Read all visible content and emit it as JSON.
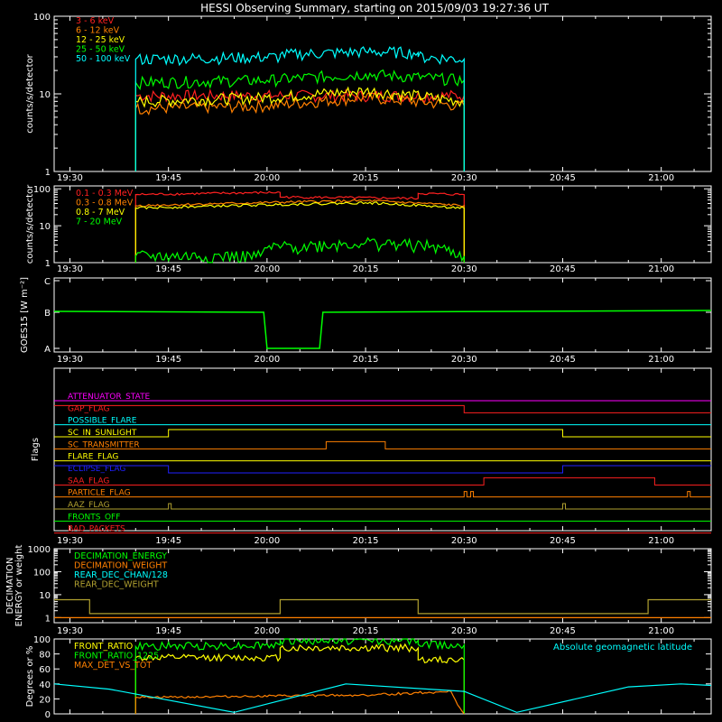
{
  "title": "HESSI Observing Summary, starting on 2015/09/03 19:27:36 UT",
  "time_ticks": [
    "19:30",
    "19:45",
    "20:00",
    "20:15",
    "20:30",
    "20:45",
    "21:00"
  ],
  "colors": {
    "red": "#ff2020",
    "orange": "#ff8000",
    "yellow": "#ffff00",
    "green": "#00ff00",
    "cyan": "#00ffff",
    "magenta": "#ff00ff",
    "blue": "#2020ff",
    "olive": "#b0a030",
    "white": "#ffffff"
  },
  "chart_data": [
    {
      "type": "line",
      "id": "low-energy-rates",
      "ylabel": "counts/s/detector",
      "yscale": "log",
      "ylim": [
        1,
        100
      ],
      "yticks": [
        "1",
        "10",
        "100"
      ],
      "xlim": [
        "19:27:36",
        "21:07:36"
      ],
      "series": [
        {
          "name": "3 - 6 keV",
          "color": "red",
          "points": [
            [
              "19:40",
              "1"
            ],
            [
              "19:40",
              "9.5"
            ],
            [
              "20:30",
              "9.5"
            ],
            [
              "20:30",
              "1"
            ]
          ]
        },
        {
          "name": "6 - 12 keV",
          "color": "orange",
          "points": [
            [
              "19:40",
              "1"
            ],
            [
              "19:40",
              "6.5"
            ],
            [
              "20:00",
              "7"
            ],
            [
              "20:15",
              "9"
            ],
            [
              "20:30",
              "7"
            ],
            [
              "20:30",
              "1"
            ]
          ]
        },
        {
          "name": "12 - 25 keV",
          "color": "yellow",
          "points": [
            [
              "19:40",
              "1"
            ],
            [
              "19:40",
              "8"
            ],
            [
              "20:00",
              "9"
            ],
            [
              "20:15",
              "11"
            ],
            [
              "20:30",
              "8"
            ],
            [
              "20:30",
              "1"
            ]
          ]
        },
        {
          "name": "25 - 50 keV",
          "color": "green",
          "points": [
            [
              "19:40",
              "1"
            ],
            [
              "19:40",
              "14"
            ],
            [
              "20:00",
              "15"
            ],
            [
              "20:15",
              "18"
            ],
            [
              "20:30",
              "15"
            ],
            [
              "20:30",
              "1"
            ]
          ]
        },
        {
          "name": "50 - 100 keV",
          "color": "cyan",
          "points": [
            [
              "19:40",
              "1"
            ],
            [
              "19:40",
              "28"
            ],
            [
              "20:02",
              "30"
            ],
            [
              "20:02",
              "32"
            ],
            [
              "20:15",
              "35"
            ],
            [
              "20:23",
              "34"
            ],
            [
              "20:23",
              "30"
            ],
            [
              "20:30",
              "28"
            ],
            [
              "20:30",
              "1"
            ]
          ]
        }
      ]
    },
    {
      "type": "line",
      "id": "high-energy-rates",
      "ylabel": "counts/s/detector",
      "yscale": "log",
      "ylim": [
        1,
        120
      ],
      "yticks": [
        "1",
        "10",
        "100"
      ],
      "series": [
        {
          "name": "0.1 - 0.3 MeV",
          "color": "red",
          "points": [
            [
              "19:40",
              "1"
            ],
            [
              "19:40",
              "70"
            ],
            [
              "20:02",
              "80"
            ],
            [
              "20:02",
              "60"
            ],
            [
              "20:23",
              "55"
            ],
            [
              "20:23",
              "75"
            ],
            [
              "20:30",
              "70"
            ],
            [
              "20:30",
              "1"
            ]
          ]
        },
        {
          "name": "0.3 - 0.8 MeV",
          "color": "orange",
          "points": [
            [
              "19:40",
              "1"
            ],
            [
              "19:40",
              "35"
            ],
            [
              "20:15",
              "48"
            ],
            [
              "20:30",
              "35"
            ],
            [
              "20:30",
              "1"
            ]
          ]
        },
        {
          "name": "0.8 - 7 MeV",
          "color": "yellow",
          "points": [
            [
              "19:40",
              "1"
            ],
            [
              "19:40",
              "30"
            ],
            [
              "20:15",
              "42"
            ],
            [
              "20:30",
              "30"
            ],
            [
              "20:30",
              "1"
            ]
          ]
        },
        {
          "name": "7 - 20 MeV",
          "color": "green",
          "points": [
            [
              "19:40",
              "1"
            ],
            [
              "19:40",
              "1.5"
            ],
            [
              "19:59",
              "1.5"
            ],
            [
              "20:00",
              "2.5"
            ],
            [
              "20:15",
              "3.5"
            ],
            [
              "20:25",
              "2.8"
            ],
            [
              "20:30",
              "1.5"
            ],
            [
              "20:30",
              "1"
            ]
          ]
        }
      ]
    },
    {
      "type": "line",
      "id": "goes",
      "ylabel": "GOES15 [W m⁻²]",
      "yscale": "log",
      "ylim": [
        "A",
        "C"
      ],
      "yticks": [
        "A",
        "B",
        "C"
      ],
      "series": [
        {
          "name": "GOES",
          "color": "green",
          "points": [
            [
              "19:27:36",
              "B 0.6"
            ],
            [
              "19:59:30",
              "B 0.5"
            ],
            [
              "20:00",
              "A"
            ],
            [
              "20:08",
              "A"
            ],
            [
              "20:08:30",
              "B 0.5"
            ],
            [
              "21:07:36",
              "B 0.7"
            ]
          ]
        }
      ]
    },
    {
      "type": "line",
      "id": "flags",
      "ylabel": "Flags",
      "flags": [
        {
          "name": "ATTENUATOR_STATE",
          "color": "magenta",
          "transitions": []
        },
        {
          "name": "GAP_FLAG",
          "color": "red",
          "transitions": [
            "20:30"
          ]
        },
        {
          "name": "POSSIBLE_FLARE",
          "color": "cyan",
          "transitions": []
        },
        {
          "name": "SC_IN_SUNLIGHT",
          "color": "yellow",
          "transitions": [
            "19:45",
            "20:45"
          ]
        },
        {
          "name": "SC_TRANSMITTER",
          "color": "orange",
          "transitions": [
            "20:09",
            "20:18"
          ]
        },
        {
          "name": "FLARE_FLAG",
          "color": "yellow",
          "transitions": []
        },
        {
          "name": "ECLIPSE_FLAG",
          "color": "blue",
          "transitions": [
            "19:45",
            "20:45"
          ]
        },
        {
          "name": "SAA_FLAG",
          "color": "red",
          "transitions": [
            "20:33",
            "20:59"
          ]
        },
        {
          "name": "PARTICLE_FLAG",
          "color": "orange",
          "transitions": [
            "20:30",
            "20:31",
            "21:04"
          ]
        },
        {
          "name": "AAZ_FLAG",
          "color": "olive",
          "transitions": [
            "19:45",
            "20:45"
          ]
        },
        {
          "name": "FRONTS_OFF",
          "color": "green",
          "transitions": []
        },
        {
          "name": "BAD_PACKETS",
          "color": "red",
          "transitions": []
        }
      ]
    },
    {
      "type": "line",
      "id": "decimation",
      "ylabel": "DECIMATION ENERGY or weight",
      "yscale": "log",
      "ylim": [
        0.6,
        1000
      ],
      "yticks": [
        "1",
        "10",
        "100",
        "1000"
      ],
      "series": [
        {
          "name": "DECIMATION_ENERGY",
          "color": "green",
          "points": []
        },
        {
          "name": "DECIMATION_WEIGHT",
          "color": "orange",
          "points": [
            [
              "19:27:36",
              "1"
            ],
            [
              "21:07:36",
              "1"
            ]
          ]
        },
        {
          "name": "REAR_DEC_CHAN/128",
          "color": "cyan",
          "points": []
        },
        {
          "name": "REAR_DEC_WEIGHT",
          "color": "olive",
          "points": [
            [
              "19:27:36",
              "6"
            ],
            [
              "19:33",
              "6"
            ],
            [
              "19:33",
              "1.5"
            ],
            [
              "20:02",
              "1.5"
            ],
            [
              "20:02",
              "6"
            ],
            [
              "20:23",
              "6"
            ],
            [
              "20:23",
              "1.5"
            ],
            [
              "20:58",
              "1.5"
            ],
            [
              "20:58",
              "6"
            ],
            [
              "21:07:36",
              "6"
            ]
          ]
        }
      ]
    },
    {
      "type": "line",
      "id": "ratios",
      "ylabel": "Degrees or %",
      "ylim": [
        0,
        100
      ],
      "yticks": [
        "0",
        "20",
        "40",
        "60",
        "80",
        "100"
      ],
      "annotation": "Absolute geomagnetic latitude",
      "series": [
        {
          "name": "FRONT_RATIO",
          "color": "yellow",
          "points": [
            [
              "19:40",
              "0"
            ],
            [
              "19:40",
              "75"
            ],
            [
              "20:02",
              "75"
            ],
            [
              "20:02",
              "88"
            ],
            [
              "20:23",
              "88"
            ],
            [
              "20:23",
              "72"
            ],
            [
              "20:30",
              "72"
            ],
            [
              "20:30",
              "0"
            ]
          ]
        },
        {
          "name": "FRONT_RATIO_1225",
          "color": "green",
          "points": [
            [
              "19:40",
              "0"
            ],
            [
              "19:40",
              "90"
            ],
            [
              "20:02",
              "92"
            ],
            [
              "20:02",
              "98"
            ],
            [
              "20:23",
              "98"
            ],
            [
              "20:23",
              "93"
            ],
            [
              "20:30",
              "92"
            ],
            [
              "20:30",
              "0"
            ]
          ]
        },
        {
          "name": "MAX_DET_VS_TOT",
          "color": "orange",
          "points": [
            [
              "19:40",
              "0"
            ],
            [
              "19:40",
              "22"
            ],
            [
              "20:15",
              "25"
            ],
            [
              "20:28",
              "30"
            ],
            [
              "20:29",
              "12"
            ],
            [
              "20:30",
              "0"
            ]
          ]
        },
        {
          "name": "Absolute geomagnetic latitude",
          "color": "cyan",
          "points": [
            [
              "19:27:36",
              "40"
            ],
            [
              "19:36",
              "33"
            ],
            [
              "19:55",
              "2"
            ],
            [
              "20:12",
              "40"
            ],
            [
              "20:30",
              "30"
            ],
            [
              "20:38",
              "2"
            ],
            [
              "20:55",
              "36"
            ],
            [
              "21:03",
              "40"
            ],
            [
              "21:07:36",
              "38"
            ]
          ]
        }
      ]
    }
  ]
}
